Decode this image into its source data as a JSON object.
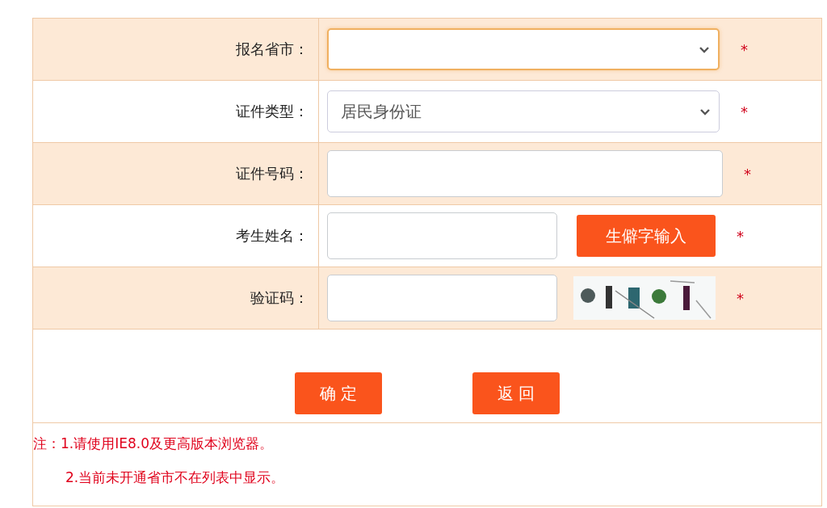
{
  "form_rows": [
    {
      "label": "报名省市：",
      "kind": "select",
      "value": "",
      "focused": true,
      "required": "*"
    },
    {
      "label": "证件类型：",
      "kind": "select",
      "value": "居民身份证",
      "focused": false,
      "required": "*"
    },
    {
      "label": "证件号码：",
      "kind": "input",
      "focused": false,
      "required": "*"
    },
    {
      "label": "考生姓名：",
      "kind": "input_button",
      "focused": false,
      "button": "生僻字输入",
      "required": "*"
    },
    {
      "label": "验证码：",
      "kind": "captcha",
      "focused": false,
      "required": "*"
    }
  ],
  "buttons": [
    "确 定",
    "返 回"
  ],
  "notes": [
    "注：1.请使用IE8.0及更高版本浏览器。",
    "2.当前未开通省市不在列表中显示。"
  ]
}
